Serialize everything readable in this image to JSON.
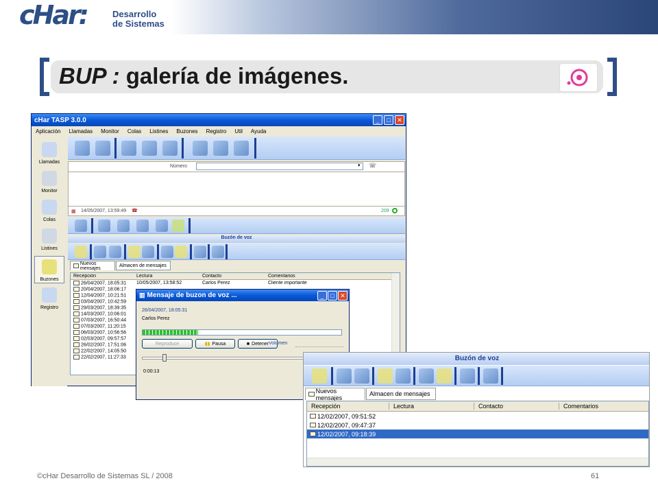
{
  "slide": {
    "logo_main": "cHar:",
    "logo_line1": "Desarrollo",
    "logo_line2": "de Sistemas",
    "title_prefix": "BUP :",
    "title_rest": " galería de imágenes.",
    "footer": "©cHar Desarrollo de Sistemas SL / 2008",
    "page": "61"
  },
  "app": {
    "title": "cHar TASP 3.0.0",
    "menu": [
      "Aplicación",
      "Llamadas",
      "Monitor",
      "Colas",
      "Listines",
      "Buzones",
      "Registro",
      "Util",
      "Ayuda"
    ],
    "sidebar": [
      "Llamadas",
      "Monitor",
      "Colas",
      "Listines",
      "Buzones",
      "Registro"
    ],
    "numero_label": "Número",
    "status_date": "14/05/2007, 13:59:49",
    "status_count": "209",
    "section_title": "Buzón de voz",
    "tabs": [
      "Nuevos mensajes",
      "Almacen de mensajes"
    ],
    "columns": [
      "Recepción",
      "Lectura",
      "Contacto",
      "Comentarios"
    ],
    "rows": [
      [
        "26/04/2007, 18:05:31",
        "10/05/2007, 13:58:52",
        "Carlos Perez",
        "Cliente importante"
      ],
      [
        "20/04/2007, 18:06:17",
        "",
        "",
        ""
      ],
      [
        "12/04/2007, 10:21:51",
        "",
        "",
        ""
      ],
      [
        "03/04/2007, 10:42:59",
        "",
        "",
        ""
      ],
      [
        "29/03/2007, 18:39:35",
        "",
        "",
        ""
      ],
      [
        "14/03/2007, 10:06:01",
        "",
        "",
        ""
      ],
      [
        "07/03/2007, 16:50:44",
        "",
        "",
        ""
      ],
      [
        "07/03/2007, 11:20:15",
        "",
        "",
        ""
      ],
      [
        "06/03/2007, 10:56:56",
        "",
        "",
        ""
      ],
      [
        "02/03/2007, 09:57:57",
        "",
        "",
        ""
      ],
      [
        "26/02/2007, 17:51:06",
        "",
        "",
        ""
      ],
      [
        "22/02/2007, 14:05:50",
        "",
        "",
        ""
      ],
      [
        "22/02/2007, 11:27:33",
        "",
        "",
        ""
      ]
    ]
  },
  "dialog": {
    "title": "Mensaje de buzon de voz ...",
    "date": "26/04/2007, 18:05:31",
    "contact": "Carlos Perez",
    "btn_play": "Reproduce",
    "btn_pause": "Pausa",
    "btn_stop": "Detener",
    "volume_label": "Volumen",
    "time": "0:00:13",
    "progress": 0.28
  },
  "zoom": {
    "section_title": "Buzón de voz",
    "tabs": [
      "Nuevos mensajes",
      "Almacen de mensajes"
    ],
    "columns": [
      "Recepción",
      "Lectura",
      "Contacto",
      "Comentarios"
    ],
    "rows": [
      "12/02/2007, 09:51:52",
      "12/02/2007, 09:47:37",
      "12/02/2007, 09:18:39"
    ],
    "selected_index": 2
  },
  "colors": {
    "brand": "#2d4f86",
    "xp_blue": "#0a58d8",
    "selection": "#316ac5"
  }
}
